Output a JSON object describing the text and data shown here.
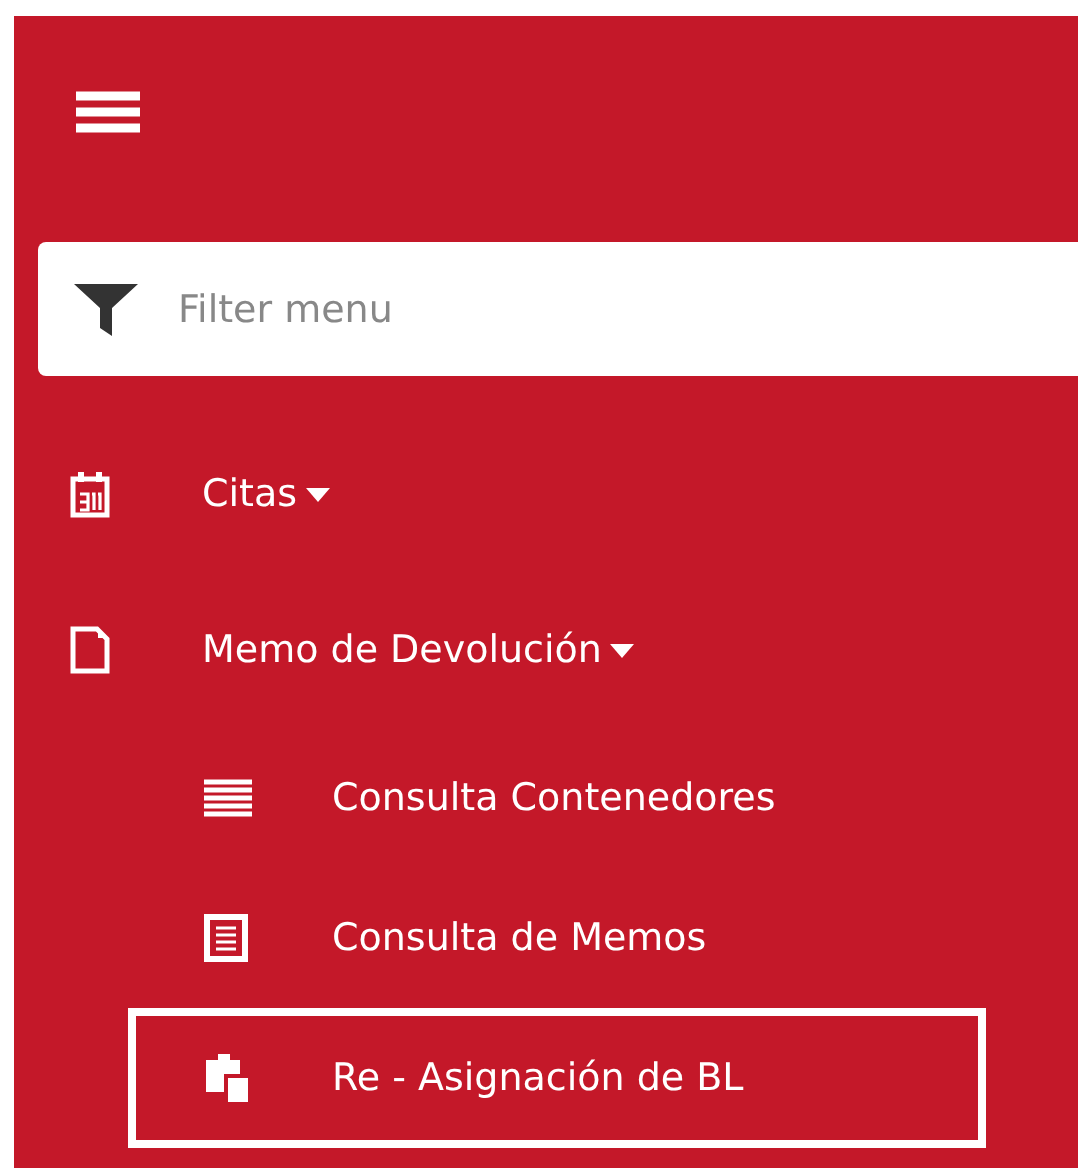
{
  "filter": {
    "placeholder": "Filter menu"
  },
  "menu": [
    {
      "label": "Citas"
    },
    {
      "label": "Memo de Devolución",
      "children": [
        {
          "label": "Consulta Contenedores",
          "selected": false
        },
        {
          "label": "Consulta de Memos",
          "selected": false
        },
        {
          "label": "Re - Asignación de BL",
          "selected": true
        }
      ]
    }
  ]
}
